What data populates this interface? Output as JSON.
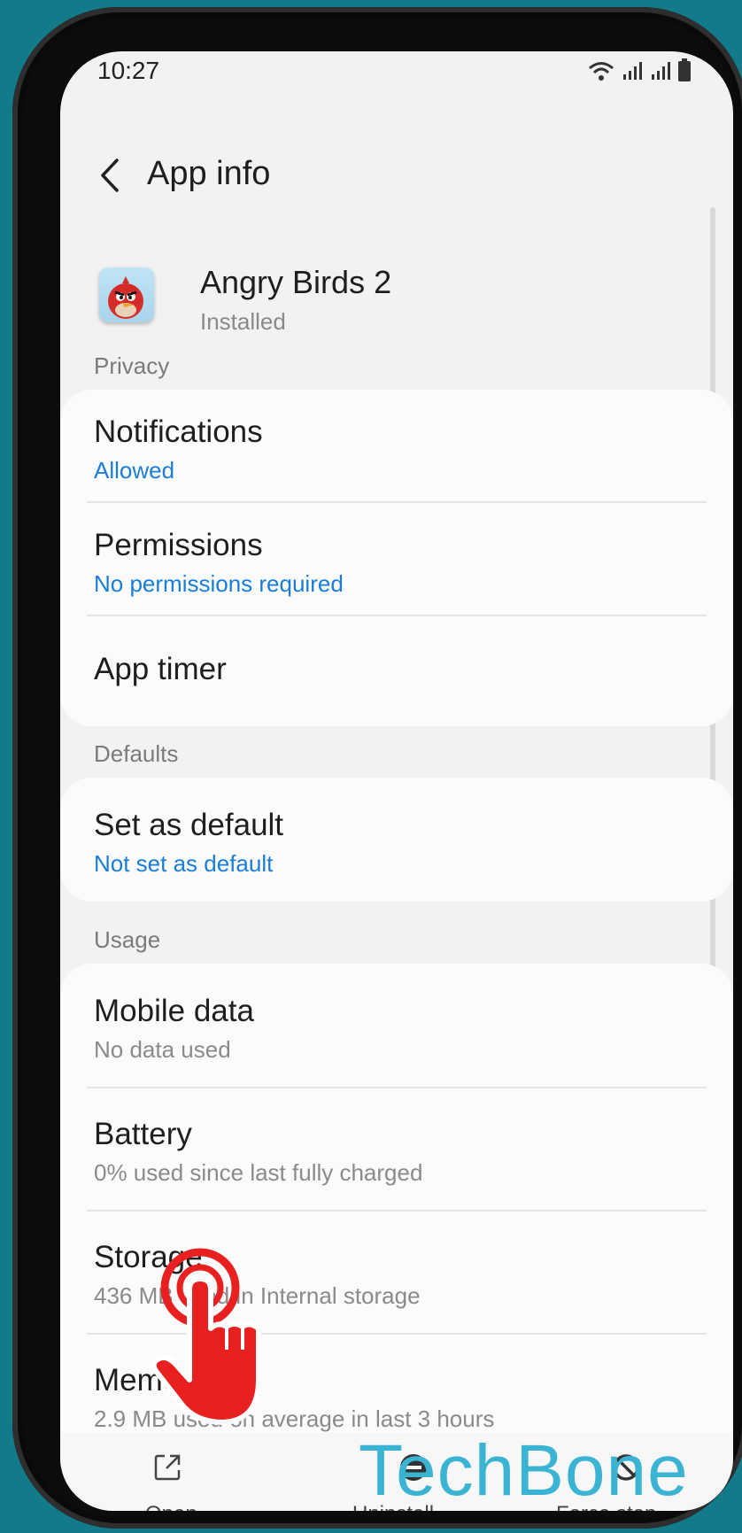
{
  "status_bar": {
    "time": "10:27"
  },
  "app_bar": {
    "title": "App info"
  },
  "app": {
    "name": "Angry Birds 2",
    "status": "Installed"
  },
  "sections": {
    "privacy": "Privacy",
    "defaults": "Defaults",
    "usage": "Usage"
  },
  "rows": {
    "notifications": {
      "title": "Notifications",
      "subtitle": "Allowed"
    },
    "permissions": {
      "title": "Permissions",
      "subtitle": "No permissions required"
    },
    "app_timer": {
      "title": "App timer"
    },
    "set_as_default": {
      "title": "Set as default",
      "subtitle": "Not set as default"
    },
    "mobile_data": {
      "title": "Mobile data",
      "subtitle": "No data used"
    },
    "battery": {
      "title": "Battery",
      "subtitle": "0% used since last fully charged"
    },
    "storage": {
      "title": "Storage",
      "subtitle": "436 MB used in Internal storage"
    },
    "memory": {
      "title": "Memory",
      "subtitle": "2.9 MB used on average in last 3 hours"
    }
  },
  "bottom_bar": {
    "open": "Open",
    "uninstall": "Uninstall",
    "force_stop": "Force stop"
  },
  "watermark": "TechBone",
  "icons": {
    "back": "chevron-left-icon",
    "wifi": "wifi-icon",
    "signal": "signal-icon",
    "battery": "battery-icon",
    "open": "open-external-icon",
    "uninstall": "uninstall-icon",
    "force_stop": "block-icon",
    "tap": "hand-tap-icon"
  },
  "colors": {
    "accent_link": "#1a7dd6",
    "background": "#f2f2f2",
    "card": "#fbfbfb",
    "frame_bg": "#137a8a",
    "watermark": "#3bb4d4",
    "hand": "#e82020"
  }
}
